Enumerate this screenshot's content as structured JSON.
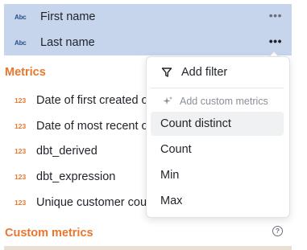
{
  "dimensions": [
    {
      "type_icon": "Abc",
      "label": "First name"
    },
    {
      "type_icon": "Abc",
      "label": "Last name"
    }
  ],
  "more_glyph": "•••",
  "metrics_section": {
    "title": "Metrics",
    "items": [
      {
        "type_icon": "123",
        "label": "Date of first created o"
      },
      {
        "type_icon": "123",
        "label": "Date of most recent o"
      },
      {
        "type_icon": "123",
        "label": "dbt_derived"
      },
      {
        "type_icon": "123",
        "label": "dbt_expression"
      },
      {
        "type_icon": "123",
        "label": "Unique customer cou"
      }
    ]
  },
  "custom_metrics_section": {
    "title": "Custom metrics",
    "help_glyph": "?"
  },
  "context_menu": {
    "add_filter": "Add filter",
    "custom_metrics_header": "Add custom metrics",
    "options": [
      "Count distinct",
      "Count",
      "Min",
      "Max"
    ]
  },
  "colors": {
    "accent": "#e8772e",
    "dimension_highlight": "#c6d5eb",
    "dimension_icon": "#2c4f8c"
  }
}
